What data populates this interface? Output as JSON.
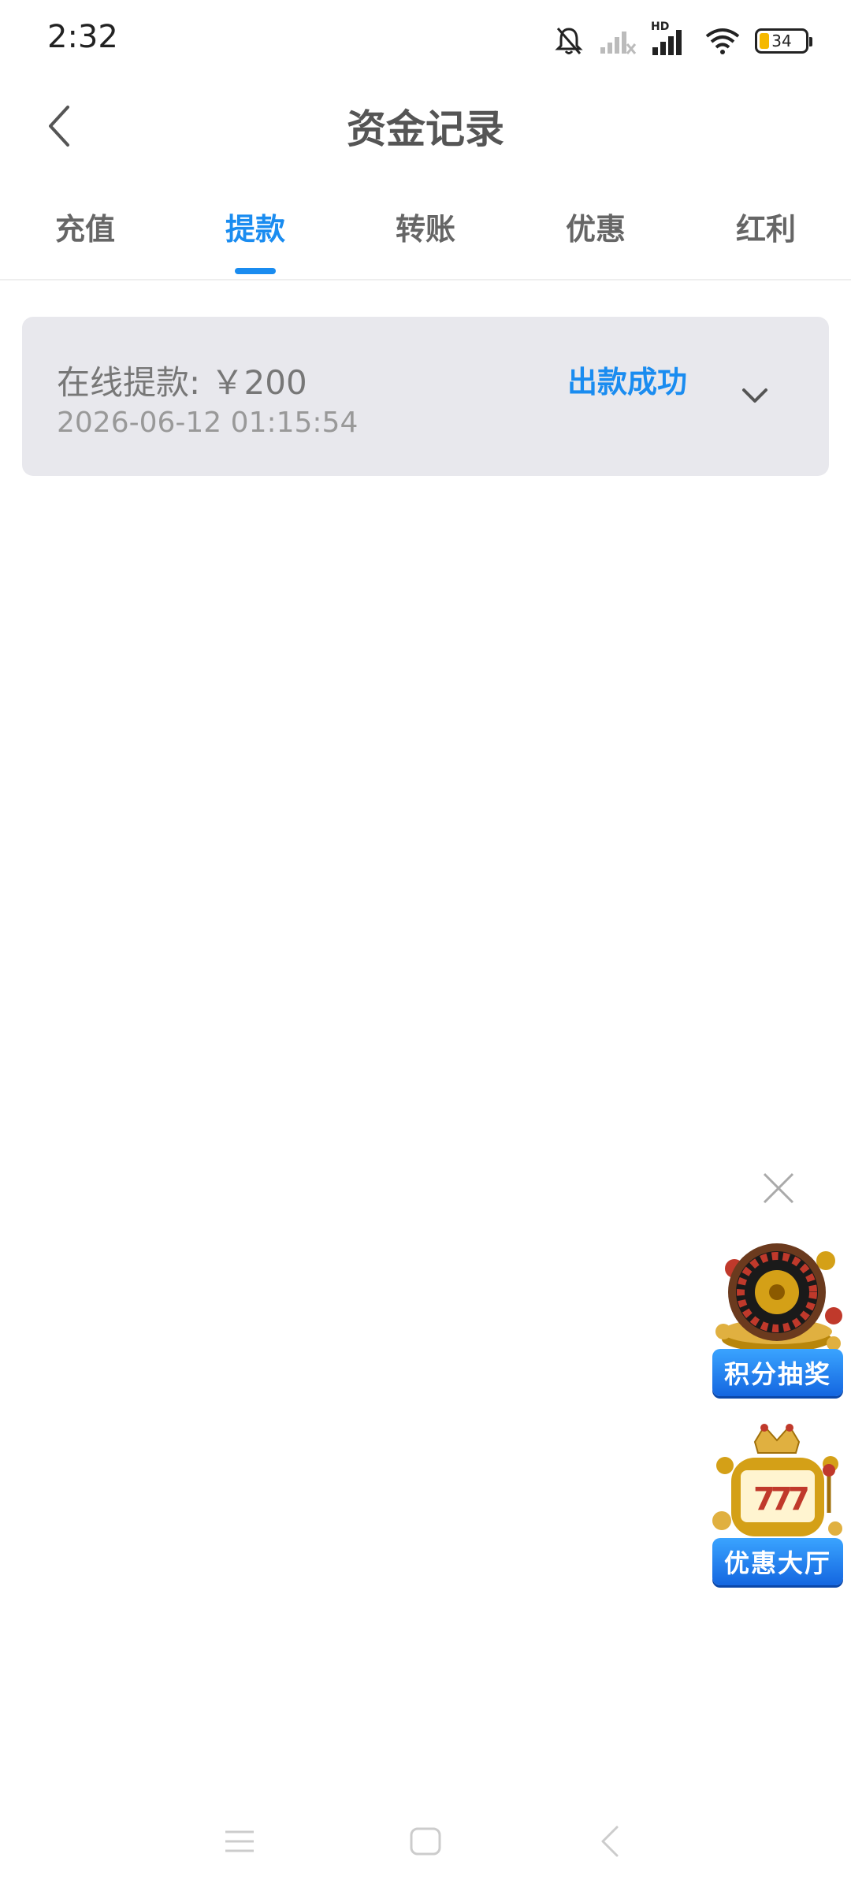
{
  "status_bar": {
    "time": "2:32",
    "battery_level": "34",
    "network_label": "HD",
    "icons": [
      "bell-muted-icon",
      "signal-off-icon",
      "signal-hd-icon",
      "wifi-icon",
      "battery-icon"
    ]
  },
  "header": {
    "title": "资金记录",
    "back_icon": "chevron-left-icon"
  },
  "tabs": [
    {
      "label": "充值",
      "active": false
    },
    {
      "label": "提款",
      "active": true
    },
    {
      "label": "转账",
      "active": false
    },
    {
      "label": "优惠",
      "active": false
    },
    {
      "label": "红利",
      "active": false
    }
  ],
  "records": [
    {
      "title": "在线提款: ￥200",
      "time": "2026-06-12 01:15:54",
      "status": "出款成功",
      "expand_icon": "chevron-down-icon"
    }
  ],
  "floating": {
    "close_icon": "close-icon",
    "promos": [
      {
        "label": "积分抽奖",
        "art": "roulette-icon"
      },
      {
        "label": "优惠大厅",
        "art": "slot-machine-icon"
      }
    ]
  },
  "colors": {
    "accent": "#1a8cf0",
    "card_bg": "#e8e8ed",
    "battery_fill": "#f5b800"
  }
}
